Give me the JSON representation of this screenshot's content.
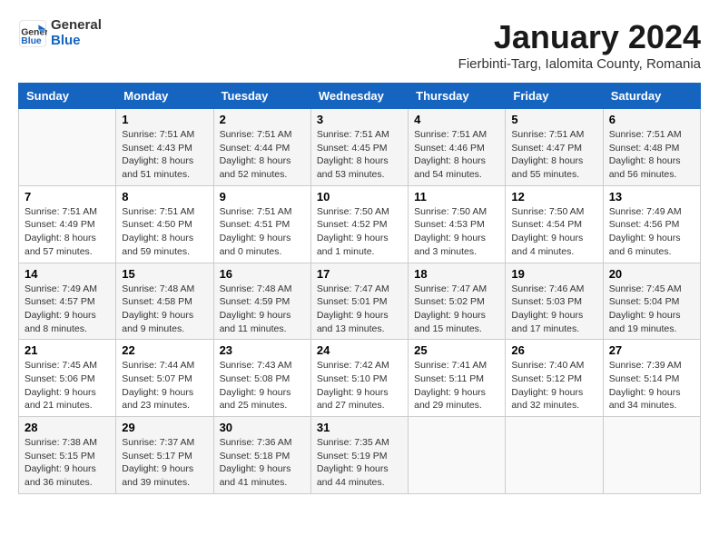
{
  "logo": {
    "line1": "General",
    "line2": "Blue"
  },
  "title": "January 2024",
  "location": "Fierbinti-Targ, Ialomita County, Romania",
  "headers": [
    "Sunday",
    "Monday",
    "Tuesday",
    "Wednesday",
    "Thursday",
    "Friday",
    "Saturday"
  ],
  "weeks": [
    [
      {
        "day": "",
        "info": ""
      },
      {
        "day": "1",
        "info": "Sunrise: 7:51 AM\nSunset: 4:43 PM\nDaylight: 8 hours\nand 51 minutes."
      },
      {
        "day": "2",
        "info": "Sunrise: 7:51 AM\nSunset: 4:44 PM\nDaylight: 8 hours\nand 52 minutes."
      },
      {
        "day": "3",
        "info": "Sunrise: 7:51 AM\nSunset: 4:45 PM\nDaylight: 8 hours\nand 53 minutes."
      },
      {
        "day": "4",
        "info": "Sunrise: 7:51 AM\nSunset: 4:46 PM\nDaylight: 8 hours\nand 54 minutes."
      },
      {
        "day": "5",
        "info": "Sunrise: 7:51 AM\nSunset: 4:47 PM\nDaylight: 8 hours\nand 55 minutes."
      },
      {
        "day": "6",
        "info": "Sunrise: 7:51 AM\nSunset: 4:48 PM\nDaylight: 8 hours\nand 56 minutes."
      }
    ],
    [
      {
        "day": "7",
        "info": "Sunrise: 7:51 AM\nSunset: 4:49 PM\nDaylight: 8 hours\nand 57 minutes."
      },
      {
        "day": "8",
        "info": "Sunrise: 7:51 AM\nSunset: 4:50 PM\nDaylight: 8 hours\nand 59 minutes."
      },
      {
        "day": "9",
        "info": "Sunrise: 7:51 AM\nSunset: 4:51 PM\nDaylight: 9 hours\nand 0 minutes."
      },
      {
        "day": "10",
        "info": "Sunrise: 7:50 AM\nSunset: 4:52 PM\nDaylight: 9 hours\nand 1 minute."
      },
      {
        "day": "11",
        "info": "Sunrise: 7:50 AM\nSunset: 4:53 PM\nDaylight: 9 hours\nand 3 minutes."
      },
      {
        "day": "12",
        "info": "Sunrise: 7:50 AM\nSunset: 4:54 PM\nDaylight: 9 hours\nand 4 minutes."
      },
      {
        "day": "13",
        "info": "Sunrise: 7:49 AM\nSunset: 4:56 PM\nDaylight: 9 hours\nand 6 minutes."
      }
    ],
    [
      {
        "day": "14",
        "info": "Sunrise: 7:49 AM\nSunset: 4:57 PM\nDaylight: 9 hours\nand 8 minutes."
      },
      {
        "day": "15",
        "info": "Sunrise: 7:48 AM\nSunset: 4:58 PM\nDaylight: 9 hours\nand 9 minutes."
      },
      {
        "day": "16",
        "info": "Sunrise: 7:48 AM\nSunset: 4:59 PM\nDaylight: 9 hours\nand 11 minutes."
      },
      {
        "day": "17",
        "info": "Sunrise: 7:47 AM\nSunset: 5:01 PM\nDaylight: 9 hours\nand 13 minutes."
      },
      {
        "day": "18",
        "info": "Sunrise: 7:47 AM\nSunset: 5:02 PM\nDaylight: 9 hours\nand 15 minutes."
      },
      {
        "day": "19",
        "info": "Sunrise: 7:46 AM\nSunset: 5:03 PM\nDaylight: 9 hours\nand 17 minutes."
      },
      {
        "day": "20",
        "info": "Sunrise: 7:45 AM\nSunset: 5:04 PM\nDaylight: 9 hours\nand 19 minutes."
      }
    ],
    [
      {
        "day": "21",
        "info": "Sunrise: 7:45 AM\nSunset: 5:06 PM\nDaylight: 9 hours\nand 21 minutes."
      },
      {
        "day": "22",
        "info": "Sunrise: 7:44 AM\nSunset: 5:07 PM\nDaylight: 9 hours\nand 23 minutes."
      },
      {
        "day": "23",
        "info": "Sunrise: 7:43 AM\nSunset: 5:08 PM\nDaylight: 9 hours\nand 25 minutes."
      },
      {
        "day": "24",
        "info": "Sunrise: 7:42 AM\nSunset: 5:10 PM\nDaylight: 9 hours\nand 27 minutes."
      },
      {
        "day": "25",
        "info": "Sunrise: 7:41 AM\nSunset: 5:11 PM\nDaylight: 9 hours\nand 29 minutes."
      },
      {
        "day": "26",
        "info": "Sunrise: 7:40 AM\nSunset: 5:12 PM\nDaylight: 9 hours\nand 32 minutes."
      },
      {
        "day": "27",
        "info": "Sunrise: 7:39 AM\nSunset: 5:14 PM\nDaylight: 9 hours\nand 34 minutes."
      }
    ],
    [
      {
        "day": "28",
        "info": "Sunrise: 7:38 AM\nSunset: 5:15 PM\nDaylight: 9 hours\nand 36 minutes."
      },
      {
        "day": "29",
        "info": "Sunrise: 7:37 AM\nSunset: 5:17 PM\nDaylight: 9 hours\nand 39 minutes."
      },
      {
        "day": "30",
        "info": "Sunrise: 7:36 AM\nSunset: 5:18 PM\nDaylight: 9 hours\nand 41 minutes."
      },
      {
        "day": "31",
        "info": "Sunrise: 7:35 AM\nSunset: 5:19 PM\nDaylight: 9 hours\nand 44 minutes."
      },
      {
        "day": "",
        "info": ""
      },
      {
        "day": "",
        "info": ""
      },
      {
        "day": "",
        "info": ""
      }
    ]
  ]
}
